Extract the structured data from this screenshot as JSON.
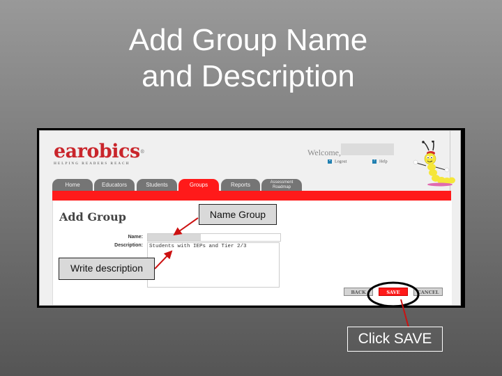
{
  "slide": {
    "title_line1": "Add Group Name",
    "title_line2": "and Description"
  },
  "app": {
    "logo": {
      "name": "earobics",
      "trademark": "®",
      "tagline": "HELPING READERS REACH"
    },
    "header": {
      "welcome": "Welcome,",
      "links": [
        {
          "label": "Logout",
          "icon": "logout-icon"
        },
        {
          "label": "Help",
          "icon": "help-icon"
        }
      ]
    },
    "tabs": [
      {
        "label": "Home",
        "active": false
      },
      {
        "label": "Educators",
        "active": false
      },
      {
        "label": "Students",
        "active": false
      },
      {
        "label": "Groups",
        "active": true
      },
      {
        "label": "Reports",
        "active": false
      },
      {
        "label": "Assessment Roadmap",
        "line1": "Assessment",
        "line2": "Roadmap",
        "active": false
      }
    ],
    "page_heading": "Add Group",
    "form": {
      "name_label": "Name:",
      "name_value": "",
      "description_label": "Description:",
      "description_value": "Students with IEPs and Tier 2/3"
    },
    "buttons": {
      "back": "BACK",
      "save": "SAVE",
      "cancel": "CANCEL"
    },
    "colors": {
      "brand_red": "#ff1a1a",
      "logo_red": "#c9252b",
      "tab_grey": "#757575"
    }
  },
  "annotations": {
    "name_group": "Name Group",
    "write_description": "Write description",
    "click_save": "Click SAVE",
    "arrow_color": "#cc1111"
  }
}
